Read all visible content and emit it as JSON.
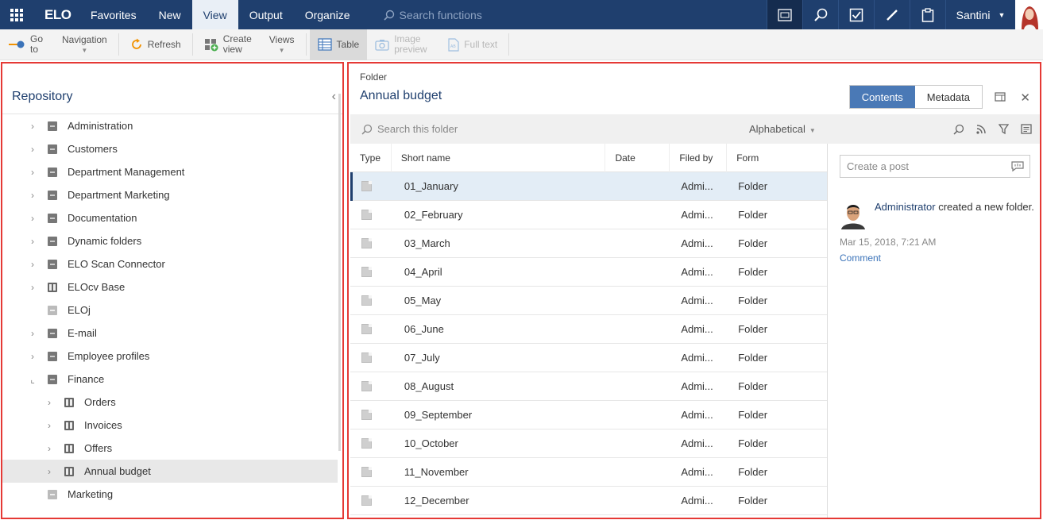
{
  "topnav": {
    "logo": "ELO",
    "menu": [
      {
        "label": "Favorites",
        "active": false
      },
      {
        "label": "New",
        "active": false
      },
      {
        "label": "View",
        "active": true
      },
      {
        "label": "Output",
        "active": false
      },
      {
        "label": "Organize",
        "active": false
      }
    ],
    "search_placeholder": "Search functions",
    "user_name": "Santini"
  },
  "toolbar": {
    "goto": "Go to",
    "navigation": "Navigation",
    "refresh": "Refresh",
    "create_view": "Create view",
    "views": "Views",
    "table": "Table",
    "image_preview": "Image preview",
    "full_text": "Full text"
  },
  "repository": {
    "title": "Repository",
    "items": [
      {
        "label": "Administration",
        "chevron": "›",
        "icon": "gray",
        "indent": 0
      },
      {
        "label": "Customers",
        "chevron": "›",
        "icon": "gray",
        "indent": 0
      },
      {
        "label": "Department Management",
        "chevron": "›",
        "icon": "gray",
        "indent": 0
      },
      {
        "label": "Department Marketing",
        "chevron": "›",
        "icon": "gray",
        "indent": 0
      },
      {
        "label": "Documentation",
        "chevron": "›",
        "icon": "gray",
        "indent": 0
      },
      {
        "label": "Dynamic folders",
        "chevron": "›",
        "icon": "gray",
        "indent": 0
      },
      {
        "label": "ELO Scan Connector",
        "chevron": "›",
        "icon": "gray",
        "indent": 0
      },
      {
        "label": "ELOcv Base",
        "chevron": "›",
        "icon": "book",
        "indent": 0
      },
      {
        "label": "ELOj",
        "chevron": "",
        "icon": "light",
        "indent": 0
      },
      {
        "label": "E-mail",
        "chevron": "›",
        "icon": "gray",
        "indent": 0
      },
      {
        "label": "Employee profiles",
        "chevron": "›",
        "icon": "gray",
        "indent": 0
      },
      {
        "label": "Finance",
        "chevron": "⌞",
        "icon": "gray",
        "indent": 0
      },
      {
        "label": "Orders",
        "chevron": "›",
        "icon": "book",
        "indent": 1
      },
      {
        "label": "Invoices",
        "chevron": "›",
        "icon": "book",
        "indent": 1
      },
      {
        "label": "Offers",
        "chevron": "›",
        "icon": "book",
        "indent": 1
      },
      {
        "label": "Annual budget",
        "chevron": "›",
        "icon": "book",
        "indent": 1,
        "selected": true
      },
      {
        "label": "Marketing",
        "chevron": "",
        "icon": "light",
        "indent": 0
      }
    ]
  },
  "main": {
    "type_label": "Folder",
    "title": "Annual budget",
    "tabs": [
      {
        "label": "Contents",
        "active": true
      },
      {
        "label": "Metadata",
        "active": false
      }
    ],
    "search_placeholder": "Search this folder",
    "sort_label": "Alphabetical",
    "columns": [
      "Type",
      "Short name",
      "Date",
      "Filed by",
      "Form"
    ],
    "rows": [
      {
        "name": "01_January",
        "date": "",
        "filed_by": "Admi...",
        "form": "Folder",
        "selected": true
      },
      {
        "name": "02_February",
        "date": "",
        "filed_by": "Admi...",
        "form": "Folder"
      },
      {
        "name": "03_March",
        "date": "",
        "filed_by": "Admi...",
        "form": "Folder"
      },
      {
        "name": "04_April",
        "date": "",
        "filed_by": "Admi...",
        "form": "Folder"
      },
      {
        "name": "05_May",
        "date": "",
        "filed_by": "Admi...",
        "form": "Folder"
      },
      {
        "name": "06_June",
        "date": "",
        "filed_by": "Admi...",
        "form": "Folder"
      },
      {
        "name": "07_July",
        "date": "",
        "filed_by": "Admi...",
        "form": "Folder"
      },
      {
        "name": "08_August",
        "date": "",
        "filed_by": "Admi...",
        "form": "Folder"
      },
      {
        "name": "09_September",
        "date": "",
        "filed_by": "Admi...",
        "form": "Folder"
      },
      {
        "name": "10_October",
        "date": "",
        "filed_by": "Admi...",
        "form": "Folder"
      },
      {
        "name": "11_November",
        "date": "",
        "filed_by": "Admi...",
        "form": "Folder"
      },
      {
        "name": "12_December",
        "date": "",
        "filed_by": "Admi...",
        "form": "Folder"
      }
    ]
  },
  "feed": {
    "post_placeholder": "Create a post",
    "entry_user": "Administrator",
    "entry_text": " created a new folder.",
    "entry_date": "Mar 15, 2018, 7:21 AM",
    "comment_label": "Comment"
  },
  "colors": {
    "nav_bg": "#1f3f6e",
    "accent": "#4a79b6",
    "highlight_border": "#e53935"
  }
}
